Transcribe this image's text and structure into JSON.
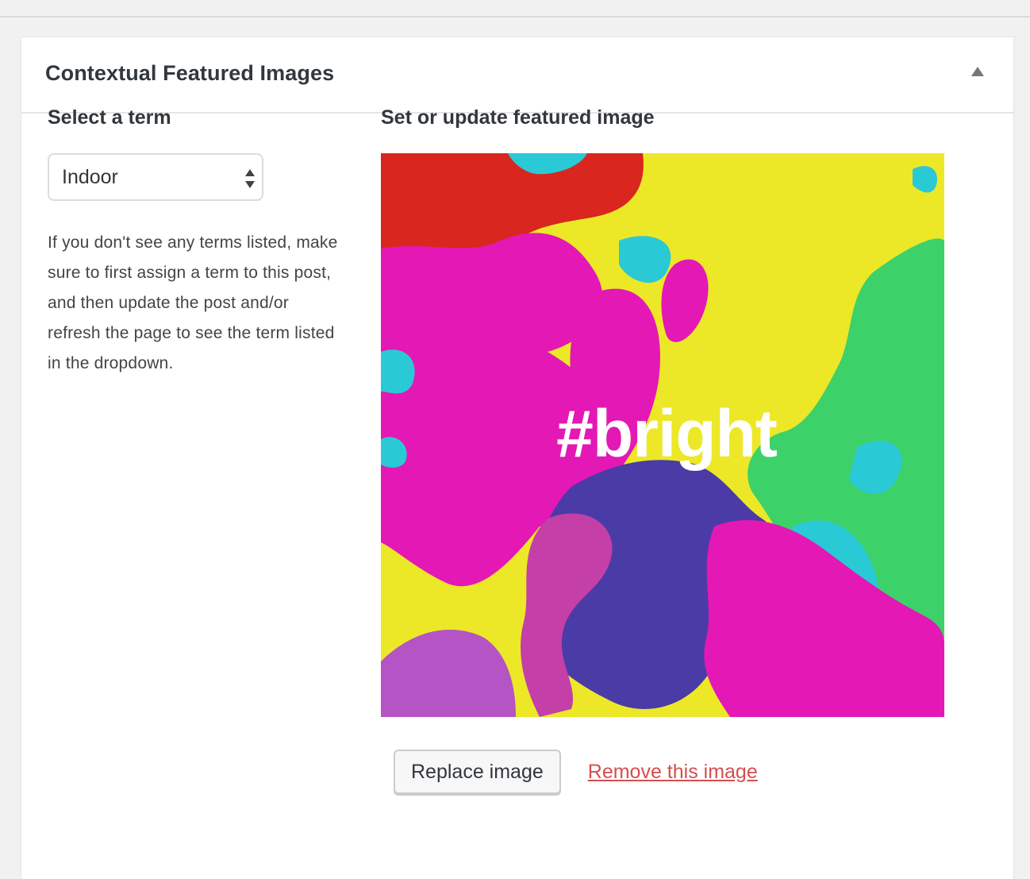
{
  "metabox": {
    "title": "Contextual Featured Images",
    "toggle_icon": "triangle-up-icon"
  },
  "term_section": {
    "heading": "Select a term",
    "select": {
      "selected_value": "Indoor",
      "icon": "select-arrows-icon"
    },
    "help_text": "If you don't see any terms listed, make sure to first assign a term to this post, and then update the post and/or refresh the page to see the term listed in the dropdown."
  },
  "image_section": {
    "heading": "Set or update featured image",
    "image_caption": "#bright",
    "image_colors": [
      "#ece828",
      "#e318b5",
      "#2ac9d6",
      "#3dd16a",
      "#d9261f",
      "#4a3ba6",
      "#b554c4"
    ]
  },
  "actions": {
    "replace_label": "Replace image",
    "remove_label": "Remove this image",
    "remove_color": "#d54e4e"
  }
}
